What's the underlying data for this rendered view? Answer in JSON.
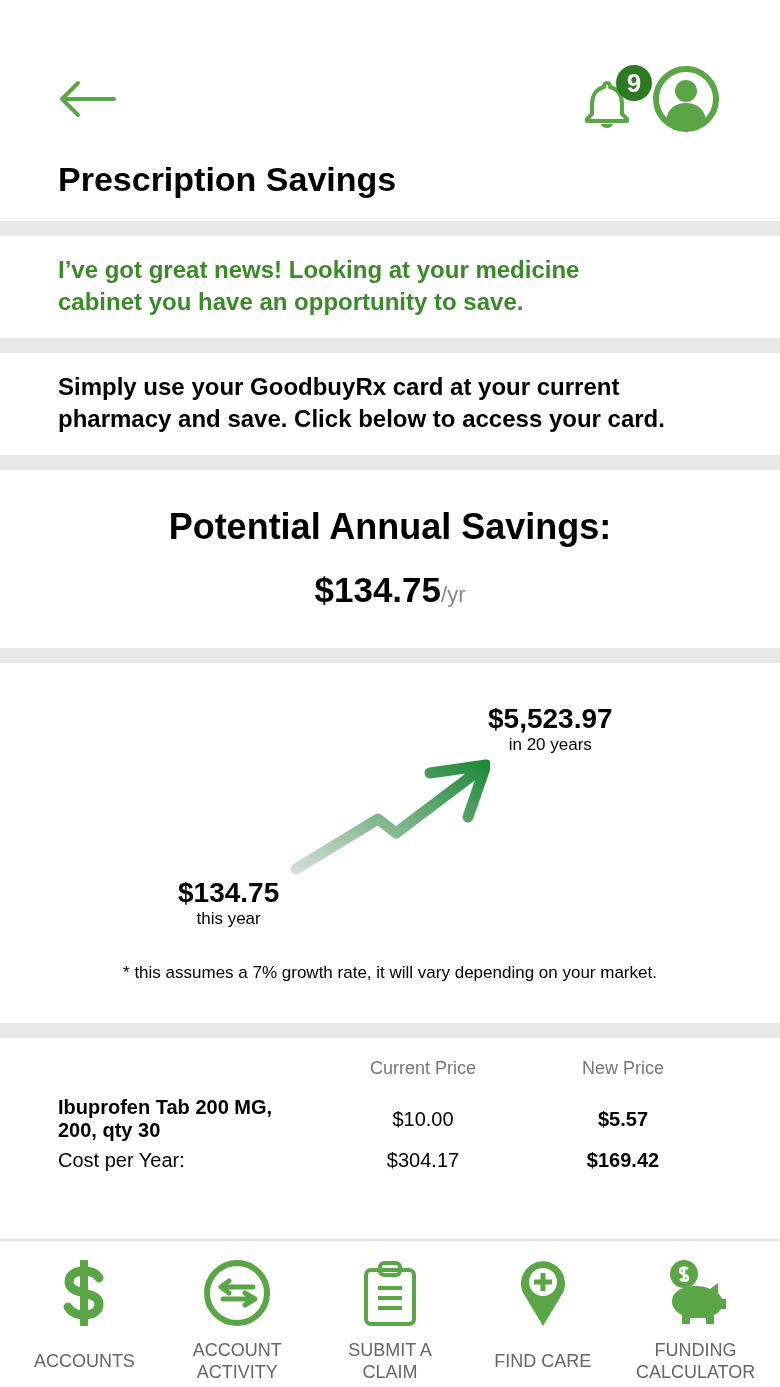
{
  "header": {
    "notification_count": "9"
  },
  "title": "Prescription Savings",
  "news": "I’ve got great news! Looking at your medicine cabinet you have an opportunity to save.",
  "instructions": "Simply use your GoodbuyRx card at your current pharmacy and save. Click below to access your card.",
  "savings": {
    "heading": "Potential Annual Savings:",
    "amount": "$134.75",
    "unit": "/yr"
  },
  "growth": {
    "future_amount": "$5,523.97",
    "future_label": "in 20 years",
    "current_amount": "$134.75",
    "current_label": "this year",
    "footnote": "* this assumes a 7% growth rate, it will vary depending on your market."
  },
  "table": {
    "columns": [
      "Current Price",
      "New Price"
    ],
    "rows": [
      {
        "label": "Ibuprofen Tab 200 MG, 200, qty 30",
        "current": "$10.00",
        "new": "$5.57"
      },
      {
        "label": "Cost per Year:",
        "current": "$304.17",
        "new": "$169.42"
      }
    ]
  },
  "nav": [
    {
      "label": "ACCOUNTS"
    },
    {
      "label": "ACCOUNT ACTIVITY"
    },
    {
      "label": "SUBMIT A CLAIM"
    },
    {
      "label": "FIND CARE"
    },
    {
      "label": "FUNDING CALCULATOR"
    }
  ]
}
